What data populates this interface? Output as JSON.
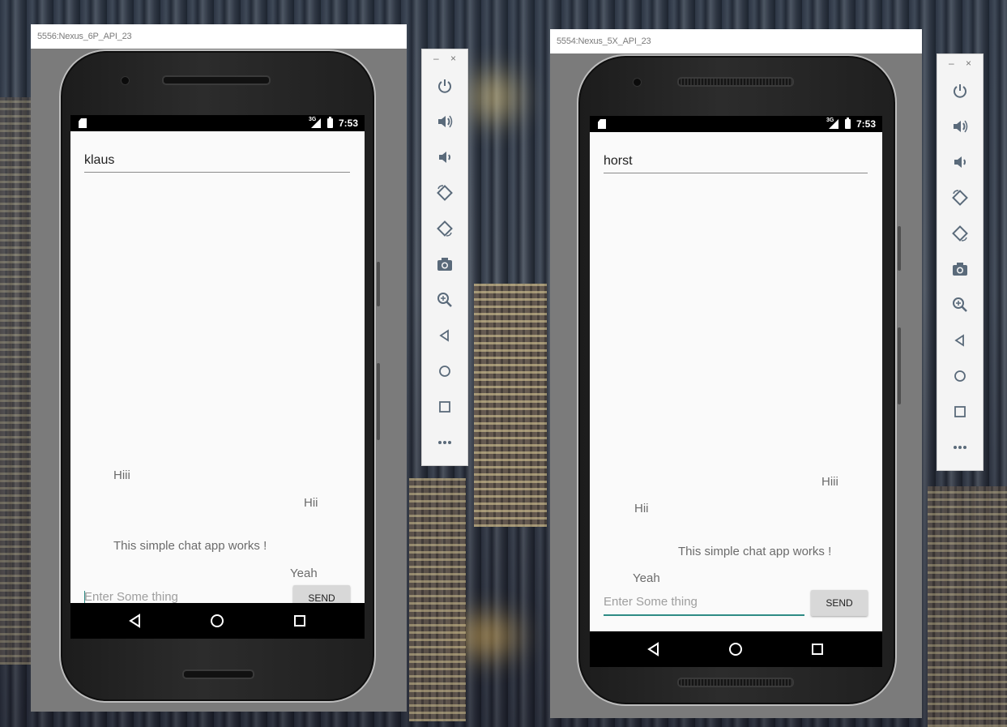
{
  "emulators": [
    {
      "title": "5556:Nexus_6P_API_23",
      "status": {
        "network": "3G",
        "time": "7:53"
      },
      "username": "klaus",
      "messages": [
        "Hiii",
        "Hii",
        "This simple chat app works !",
        "Yeah"
      ],
      "input_placeholder": "Enter Some thing",
      "send_label": "SEND"
    },
    {
      "title": "5554:Nexus_5X_API_23",
      "status": {
        "network": "3G",
        "time": "7:53"
      },
      "username": "horst",
      "messages": [
        "Hiii",
        "Hii",
        "This simple chat app works !",
        "Yeah"
      ],
      "input_placeholder": "Enter Some thing",
      "send_label": "SEND"
    }
  ],
  "toolbar": {
    "minimize": "–",
    "close": "×",
    "icons": [
      "power-icon",
      "volume-up-icon",
      "volume-down-icon",
      "rotate-left-icon",
      "rotate-right-icon",
      "camera-icon",
      "zoom-icon",
      "back-icon",
      "home-icon",
      "overview-icon",
      "more-icon"
    ]
  },
  "colors": {
    "accent": "#2e8b84",
    "toolbar_icon": "#5a6a7a",
    "emulator_bg": "#7b7b7b"
  }
}
